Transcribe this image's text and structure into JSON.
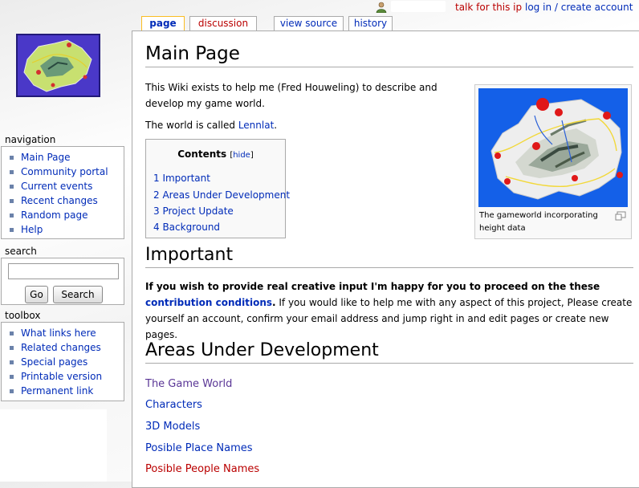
{
  "personal": {
    "user_icon": "user-icon",
    "talk_label": "talk for this ip",
    "login_label": "log in / create account"
  },
  "tabs": [
    {
      "label": "page",
      "selected": true
    },
    {
      "label": "discussion",
      "selected": false
    },
    {
      "label": "view source",
      "selected": false
    },
    {
      "label": "history",
      "selected": false
    }
  ],
  "sidebar": {
    "navigation": {
      "title": "navigation",
      "items": [
        "Main Page",
        "Community portal",
        "Current events",
        "Recent changes",
        "Random page",
        "Help"
      ]
    },
    "search": {
      "title": "search",
      "input_value": "",
      "go_label": "Go",
      "search_label": "Search"
    },
    "toolbox": {
      "title": "toolbox",
      "items": [
        "What links here",
        "Related changes",
        "Special pages",
        "Printable version",
        "Permanent link"
      ]
    }
  },
  "content": {
    "title": "Main Page",
    "intro_line1": "This Wiki exists to help me (Fred Houweling) to describe and",
    "intro_line2": "develop my game world.",
    "world_prefix": "The world is called ",
    "world_link": "Lennlat",
    "world_suffix": ".",
    "toc": {
      "title": "Contents",
      "hide_open": "[",
      "hide_label": "hide",
      "hide_close": "]",
      "items": [
        "1 Important",
        "2 Areas Under Development",
        "3 Project Update",
        "4 Background"
      ]
    },
    "thumb": {
      "caption": "The gameworld incorporating height data",
      "magnify_icon": "magnify-icon"
    },
    "important": {
      "heading": "Important",
      "bold_text": "If you wish to provide real creative input I'm happy for you to proceed on the these ",
      "link_text": "contribution conditions",
      "bold_end": ".",
      "rest_text": " If you would like to help me with any aspect of this project, Please create yourself an account, confirm your email address and jump right in and edit pages or create new pages."
    },
    "areas": {
      "heading": "Areas Under Development",
      "links": [
        "The Game World",
        "Characters",
        "3D Models",
        "Posible Place Names",
        "Posible People Names"
      ]
    }
  },
  "colors": {
    "link": "#002bb8",
    "new_link": "#ba0000",
    "visited_link": "#5a3696",
    "tab_selected_border": "#fabd23"
  }
}
